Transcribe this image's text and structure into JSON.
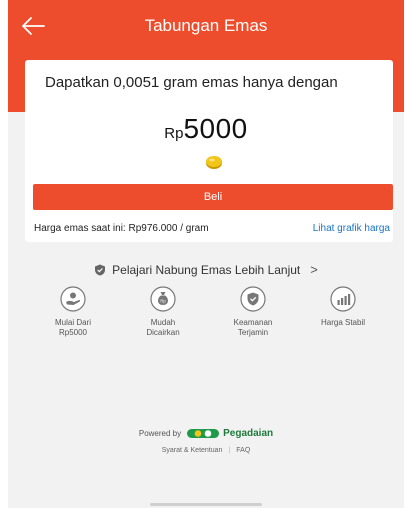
{
  "header": {
    "title": "Tabungan Emas"
  },
  "card": {
    "promo_text": "Dapatkan 0,0051 gram emas hanya dengan",
    "currency": "Rp",
    "amount": "5000",
    "buy_label": "Beli",
    "gold_price_text": "Harga emas saat ini: Rp976.000 / gram",
    "chart_link": "Lihat grafik harga"
  },
  "learn_more": {
    "label": "Pelajari Nabung Emas Lebih Lanjut",
    "chevron": ">"
  },
  "features": [
    {
      "icon": "hand-coin-icon",
      "line1": "Mulai Dari",
      "line2": "Rp5000"
    },
    {
      "icon": "money-bag-icon",
      "line1": "Mudah",
      "line2": "Dicairkan"
    },
    {
      "icon": "shield-check-icon",
      "line1": "Keamanan",
      "line2": "Terjamin"
    },
    {
      "icon": "bar-chart-icon",
      "line1": "Harga Stabil",
      "line2": ""
    }
  ],
  "footer": {
    "powered_by": "Powered by",
    "brand": "Pegadaian",
    "terms": "Syarat & Ketentuan",
    "separator": "|",
    "faq": "FAQ"
  },
  "colors": {
    "primary": "#ee4d2d",
    "link": "#1a73c9",
    "brand_green": "#1e7a3a",
    "gold": "#e6b800"
  }
}
